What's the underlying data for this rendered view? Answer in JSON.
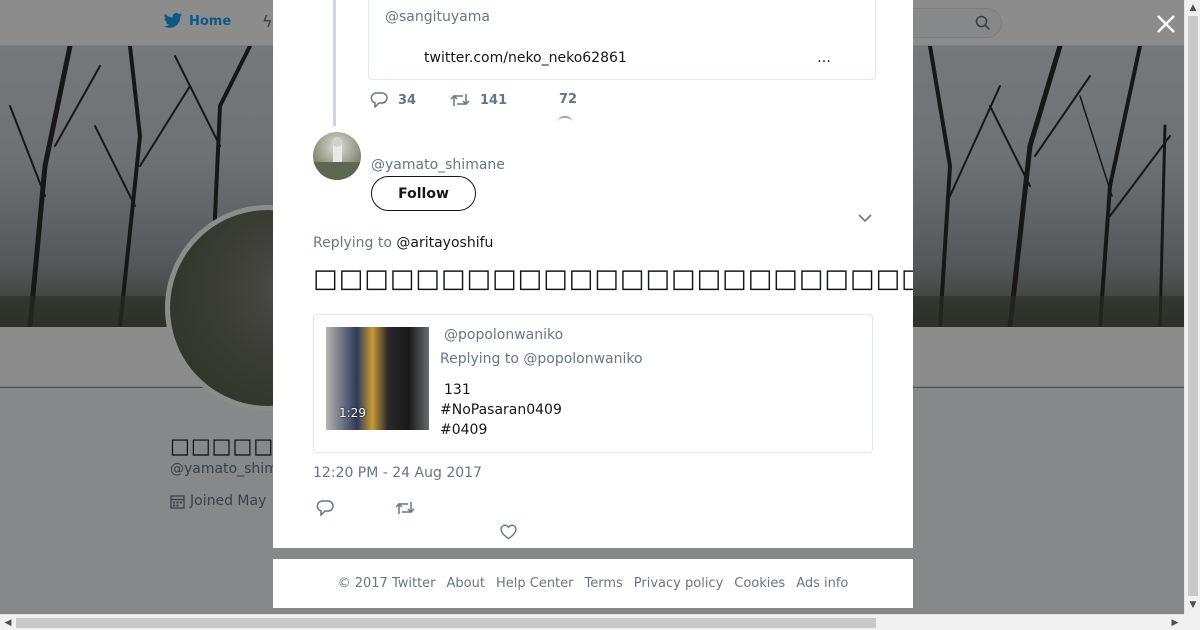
{
  "background": {
    "nav": {
      "home_label": "Home"
    },
    "profile": {
      "name": "□□□□□□",
      "handle": "@yamato_shim",
      "joined": "Joined May"
    }
  },
  "thread": {
    "quoted_tweet": {
      "handle": "@sangituyama",
      "link": "twitter.com/neko_neko62861",
      "ellipsis": "…"
    },
    "actions": {
      "replies": "34",
      "retweets": "141",
      "likes": "72"
    }
  },
  "tweet": {
    "handle": "@yamato_shimane",
    "follow_label": "Follow",
    "replying_prefix": "Replying to",
    "replying_to": "@aritayoshifu",
    "text": "□□□□□□□□□□□□□□□□□□□□□□□□□□□□□□□□□□□□□□□□□□□□□□",
    "quote": {
      "handle": "@popolonwaniko",
      "replying": "Replying to @popolonwaniko",
      "video_duration": "1:29",
      "lines": [
        "131",
        "#NoPasaran0409",
        "#0409"
      ]
    },
    "timestamp": "12:20 PM - 24 Aug 2017"
  },
  "footer": {
    "copyright": "© 2017 Twitter",
    "links": [
      "About",
      "Help Center",
      "Terms",
      "Privacy policy",
      "Cookies",
      "Ads info"
    ]
  },
  "colors": {
    "accent": "#1da1f2",
    "secondary_text": "#657786",
    "border": "#e1e8ed"
  },
  "icons": {
    "nav_home": "bird-icon",
    "close": "close-icon",
    "reply": "reply-icon",
    "retweet": "retweet-icon",
    "like": "heart-icon",
    "more": "chevron-down-icon",
    "search": "search-icon",
    "calendar": "calendar-icon"
  }
}
